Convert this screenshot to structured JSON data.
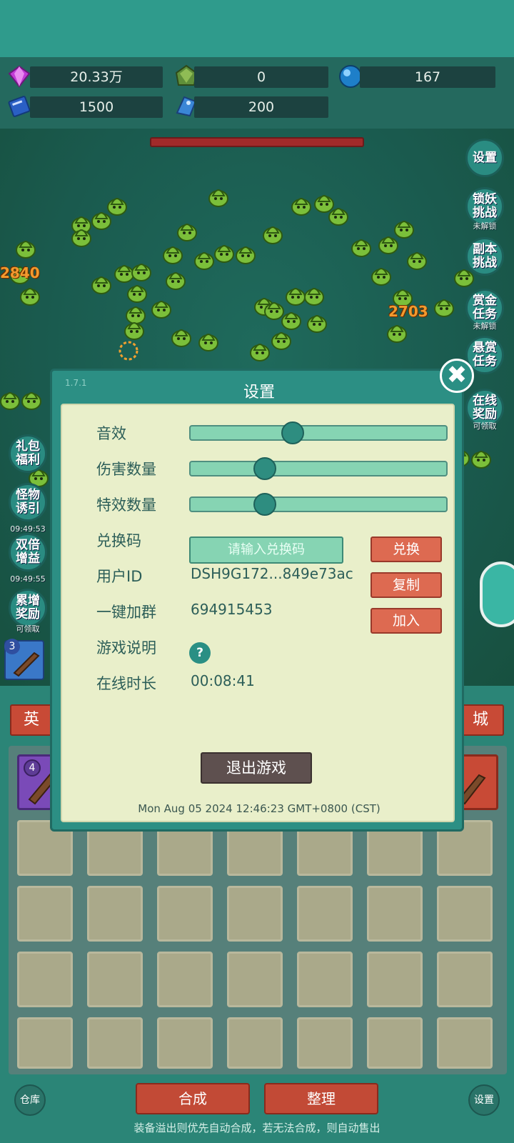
{
  "resources": {
    "gem": "20.33万",
    "crystal": "0",
    "orb": "167",
    "book": "1500",
    "fish": "200"
  },
  "side_left": [
    {
      "line1": "礼包",
      "line2": "福利",
      "sub": ""
    },
    {
      "line1": "怪物",
      "line2": "诱引",
      "sub": "09:49:53"
    },
    {
      "line1": "双倍",
      "line2": "增益",
      "sub": "09:49:55"
    },
    {
      "line1": "累增",
      "line2": "奖励",
      "sub": "可领取"
    }
  ],
  "side_right": [
    {
      "line1": "设置",
      "line2": "",
      "sub": ""
    },
    {
      "line1": "锁妖",
      "line2": "挑战",
      "sub": "未解锁"
    },
    {
      "line1": "副本",
      "line2": "挑战",
      "sub": ""
    },
    {
      "line1": "赏金",
      "line2": "任务",
      "sub": "未解锁"
    },
    {
      "line1": "悬赏",
      "line2": "任务",
      "sub": ""
    },
    {
      "line1": "在线",
      "line2": "奖励",
      "sub": "可领取"
    }
  ],
  "damage_numbers": [
    "2840",
    "2703"
  ],
  "item_badges": [
    "3",
    "4"
  ],
  "bottom": {
    "tab_left": "英",
    "tab_right": "城",
    "storage": "仓库",
    "settings": "设置",
    "merge": "合成",
    "organize": "整理",
    "tip": "装备溢出则优先自动合成，若无法合成，则自动售出"
  },
  "modal": {
    "title": "设置",
    "version": "1.7.1",
    "labels": {
      "sound": "音效",
      "damage_count": "伤害数量",
      "effect_count": "特效数量",
      "redeem": "兑换码",
      "user_id": "用户ID",
      "join_group": "一键加群",
      "game_info": "游戏说明",
      "online_time": "在线时长"
    },
    "sliders": {
      "sound": 0.4,
      "damage": 0.29,
      "effect": 0.29
    },
    "redeem_placeholder": "请输入兑换码",
    "redeem_button": "兑换",
    "user_id_value": "DSH9G172...849e73ac",
    "copy_button": "复制",
    "group_value": "694915453",
    "join_button": "加入",
    "help_icon": "?",
    "online_time_value": "00:08:41",
    "exit_button": "退出游戏",
    "datetime": "Mon Aug 05 2024 12:46:23 GMT+0800 (CST)",
    "close_icon": "✖"
  }
}
